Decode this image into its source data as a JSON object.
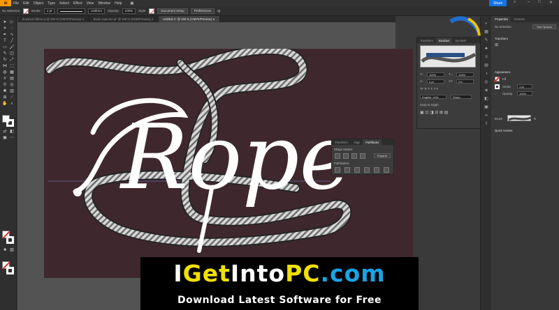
{
  "app": {
    "logo": "Ai"
  },
  "menu": [
    "File",
    "Edit",
    "Object",
    "Type",
    "Select",
    "Effect",
    "View",
    "Window",
    "Help"
  ],
  "share_label": "Share",
  "control_bar": {
    "no_selection": "No Selection",
    "stroke_label": "Stroke:",
    "stroke_value": "1 pt",
    "brush_value": "Uniform",
    "opacity_label": "Opacity:",
    "opacity_value": "100%",
    "style_label": "Style:",
    "document_setup": "Document Setup",
    "preferences": "Preferences"
  },
  "doc_tabs": [
    {
      "label": "thrushed ribbon.ai @ 150 % (CMYK/Preview)",
      "active": false
    },
    {
      "label": "Brush rope-GA.ai* @ 150 % (RGB/Preview)",
      "active": false
    },
    {
      "label": "Untitled-1* @ 150 % (CMYK/Preview)",
      "active": true
    }
  ],
  "artwork": {
    "word": "Rope",
    "text_color": "#ffffff",
    "rope_color": "#d8d8d8",
    "artboard_color": "#3e282d"
  },
  "char_panel": {
    "tabs": [
      "Transform",
      "Brushes",
      "Symbols"
    ],
    "size_value": "100%",
    "tracking_value": "100%",
    "kerning_value": "0 pt",
    "baseline_value": "0%",
    "language": "English: USA",
    "aa": "Sharp",
    "snap_label": "Snap to Glyph"
  },
  "pathfinder_panel": {
    "tabs": [
      "Transform",
      "Align",
      "Pathfinder"
    ],
    "shape_modes": "Shape Modes:",
    "expand": "Expand",
    "pathfinders": "Pathfinders:"
  },
  "properties": {
    "tabs": [
      "Properties",
      "Libraries"
    ],
    "no_selection": "No Selection",
    "tool_options": "Tool Options",
    "transform": "Transform",
    "appearance": "Appearance",
    "fill_label": "Fill",
    "stroke_label": "Stroke",
    "stroke_value": "1 pt",
    "opacity_label": "Opacity",
    "opacity_value": "100%",
    "brush_label": "Brush",
    "fx_label": "fx",
    "quick_actions": "Quick Actions"
  },
  "banner": {
    "part1": "I",
    "part2": "Get",
    "part3": "Into",
    "part4": "PC",
    "part5": ".com",
    "subtitle": "Download Latest Software for Free",
    "yellow": "#f0e000",
    "white": "#ffffff",
    "blue": "#1aa3e6"
  }
}
